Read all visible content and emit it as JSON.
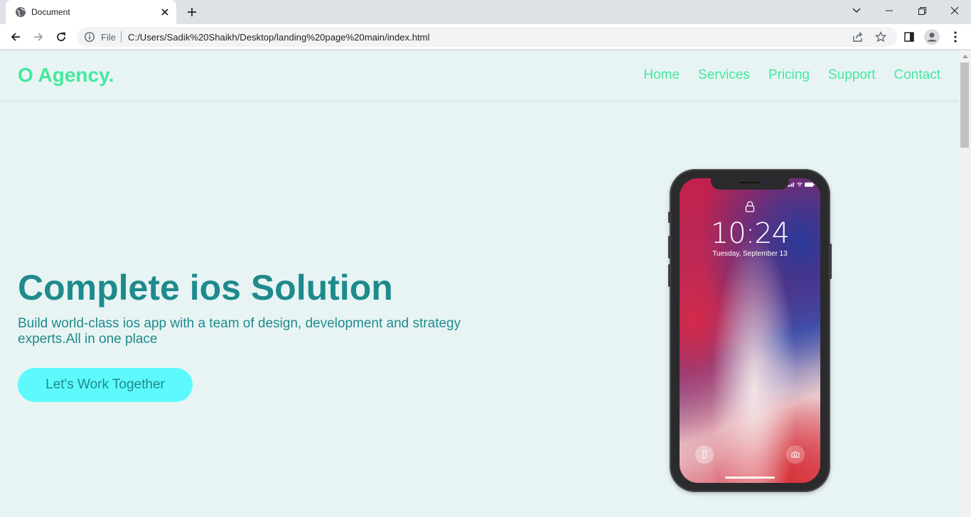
{
  "browser": {
    "tab_title": "Document",
    "scheme_label": "File",
    "url": "C:/Users/Sadik%20Shaikh/Desktop/landing%20page%20main/index.html"
  },
  "site": {
    "logo": "O Agency.",
    "nav": [
      {
        "label": "Home"
      },
      {
        "label": "Services"
      },
      {
        "label": "Pricing"
      },
      {
        "label": "Support"
      },
      {
        "label": "Contact"
      }
    ],
    "hero": {
      "title": "Complete ios Solution",
      "subtitle": "Build world-class ios app with a team of design, development and strategy experts.All in one place",
      "cta_label": "Let's Work Together"
    },
    "phone": {
      "time": "10:24",
      "date": "Tuesday, September 13"
    }
  },
  "colors": {
    "accent": "#44e89e",
    "heading": "#1f8a8c",
    "button_bg": "#5cfafd",
    "page_bg": "#e8f4f4"
  },
  "icons": [
    "globe-icon",
    "close-icon",
    "plus-icon",
    "chevron-down-icon",
    "minimize-icon",
    "restore-icon",
    "back-arrow-icon",
    "forward-arrow-icon",
    "reload-icon",
    "info-icon",
    "share-icon",
    "star-icon",
    "side-panel-icon",
    "profile-icon",
    "more-vert-icon",
    "lock-icon",
    "flashlight-icon",
    "camera-icon"
  ]
}
